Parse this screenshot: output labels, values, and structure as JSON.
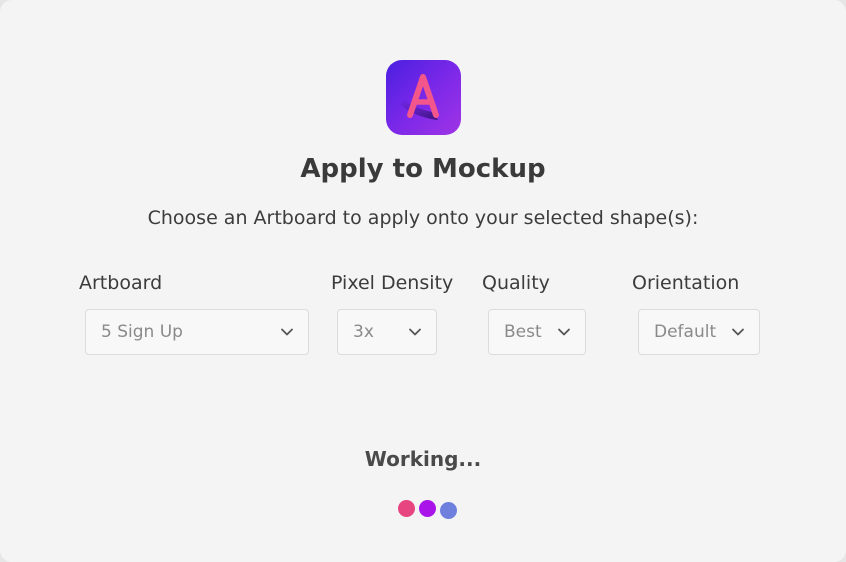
{
  "dialog": {
    "title": "Apply to Mockup",
    "subtitle": "Choose an Artboard to apply onto your selected shape(s):",
    "app_icon": "anima-logo-icon",
    "app_icon_letter": "A"
  },
  "fields": {
    "artboard": {
      "label": "Artboard",
      "value": "5 Sign Up"
    },
    "pixel_density": {
      "label": "Pixel Density",
      "value": "3x"
    },
    "quality": {
      "label": "Quality",
      "value": "Best"
    },
    "orientation": {
      "label": "Orientation",
      "value": "Default"
    }
  },
  "status": {
    "text": "Working...",
    "loader_colors": [
      "#e6457f",
      "#a914e8",
      "#6f7fdd"
    ]
  },
  "colors": {
    "background": "#f4f4f4",
    "icon_gradient_start": "#4a1fe0",
    "icon_gradient_end": "#a034e6",
    "icon_letter": "#f2568a"
  }
}
